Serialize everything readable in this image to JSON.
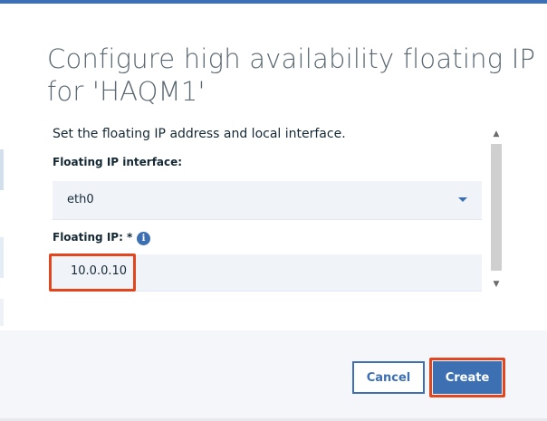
{
  "dialog": {
    "title": "Configure high availability floating IP for 'HAQM1'",
    "description": "Set the floating IP address and local interface.",
    "interface_label": "Floating IP interface:",
    "interface_value": "eth0",
    "floating_ip_label": "Floating IP: *",
    "info_glyph": "i",
    "floating_ip_value": "10.0.0.10"
  },
  "buttons": {
    "cancel": "Cancel",
    "create": "Create"
  },
  "icons": {
    "info": "info-icon",
    "caret": "chevron-down-icon",
    "scroll_up": "scroll-up-icon",
    "scroll_down": "scroll-down-icon"
  },
  "colors": {
    "accent": "#3d70b2",
    "highlight": "#e2461f",
    "title_text": "#5a6872",
    "field_bg": "#f0f4f9"
  }
}
